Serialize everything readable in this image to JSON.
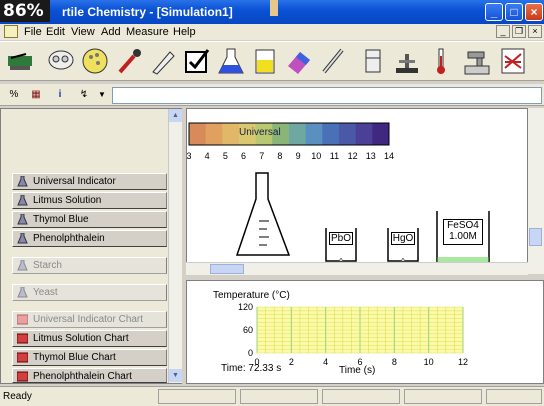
{
  "window": {
    "zoom_badge": "86%",
    "title": "Virtual Chemistry - [Simulation1]",
    "title_visible": "rtile Chemistry - [Simulation1]",
    "minimize": "_",
    "maximize": "□",
    "close": "×"
  },
  "menu": [
    "File",
    "Edit",
    "View",
    "Add",
    "Measure",
    "Help"
  ],
  "mdi": [
    "_",
    "❐",
    "×"
  ],
  "toolbar": {
    "tools": [
      "spectroscope-icon",
      "beaker-stack-icon",
      "pizza-wheel-icon",
      "dropper-icon",
      "pen-icon",
      "clipboard-check-icon",
      "flask-blue-icon",
      "beaker-yellow-icon",
      "eraser-icon",
      "thermometer-probe-icon",
      "cylinder-icon",
      "balance-icon",
      "burette-icon",
      "thermometer-icon",
      "faucet-icon",
      "clipboard-chart-icon"
    ]
  },
  "toolbar2": {
    "buttons": [
      "%",
      "▦",
      "i",
      "↯",
      "▼"
    ],
    "input_value": ""
  },
  "left_panel": {
    "items": [
      {
        "label": "Universal Indicator",
        "enabled": true
      },
      {
        "label": "Litmus Solution",
        "enabled": true
      },
      {
        "label": "Thymol Blue",
        "enabled": true
      },
      {
        "label": "Phenolphthalein",
        "enabled": true
      },
      {
        "label": "Starch",
        "enabled": false
      },
      {
        "label": "Yeast",
        "enabled": false
      },
      {
        "label": "Universal Indicator Chart",
        "enabled": false
      },
      {
        "label": "Litmus Solution Chart",
        "enabled": true
      },
      {
        "label": "Thymol Blue Chart",
        "enabled": true
      },
      {
        "label": "Phenolphthalein Chart",
        "enabled": true
      }
    ]
  },
  "bench": {
    "scale_title": "Universal",
    "scale_ticks": [
      "3",
      "4",
      "5",
      "6",
      "7",
      "8",
      "9",
      "10",
      "11",
      "12",
      "13",
      "14"
    ],
    "scale_colors": [
      "#d98a5a",
      "#e0a060",
      "#e0b868",
      "#d9c870",
      "#b8c870",
      "#8ab478",
      "#6ea8a0",
      "#5a90c0",
      "#4a70b8",
      "#4a58a8",
      "#4a4098",
      "#402880"
    ],
    "vessels": [
      {
        "name": "conical-flask",
        "label": ""
      },
      {
        "name": "beaker-pbo",
        "label": "PbO"
      },
      {
        "name": "beaker-hgo",
        "label": "HgO"
      },
      {
        "name": "beaker-feso4",
        "label": "FeSO4",
        "sub": "1.00M"
      }
    ]
  },
  "chart": {
    "title": "Temperature (°C)",
    "time_readout": "Time: 72.33 s",
    "x_title": "Time (s)"
  },
  "chart_data": {
    "type": "line",
    "title": "Temperature (°C)",
    "xlabel": "Time (s)",
    "ylabel": "",
    "x_ticks": [
      "0",
      "2",
      "4",
      "6",
      "8",
      "10",
      "12"
    ],
    "y_ticks": [
      "120",
      "60",
      "0"
    ],
    "xlim": [
      0,
      12
    ],
    "ylim": [
      0,
      120
    ],
    "series": [],
    "grid": true
  },
  "status": {
    "text": "Ready",
    "colors": {
      "accent": "#0747c2",
      "plot_bg": "#fafaa8",
      "grid": "#d8d840"
    }
  }
}
